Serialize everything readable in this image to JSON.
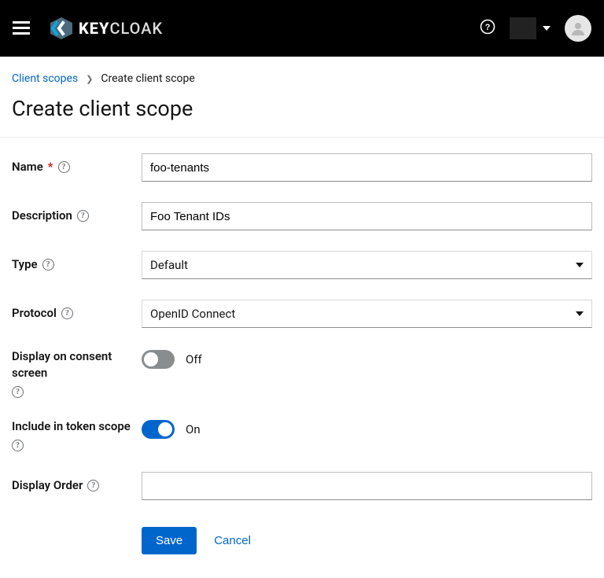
{
  "header": {
    "logo_text_bold": "Key",
    "logo_text_light": "cloak"
  },
  "breadcrumb": {
    "parent": "Client scopes",
    "current": "Create client scope"
  },
  "page": {
    "title": "Create client scope"
  },
  "form": {
    "name_label": "Name",
    "name_value": "foo-tenants",
    "description_label": "Description",
    "description_value": "Foo Tenant IDs",
    "type_label": "Type",
    "type_value": "Default",
    "protocol_label": "Protocol",
    "protocol_value": "OpenID Connect",
    "display_consent_label": "Display on consent screen",
    "display_consent_state": "Off",
    "include_token_label": "Include in token scope",
    "include_token_state": "On",
    "display_order_label": "Display Order",
    "display_order_value": ""
  },
  "actions": {
    "save": "Save",
    "cancel": "Cancel"
  }
}
